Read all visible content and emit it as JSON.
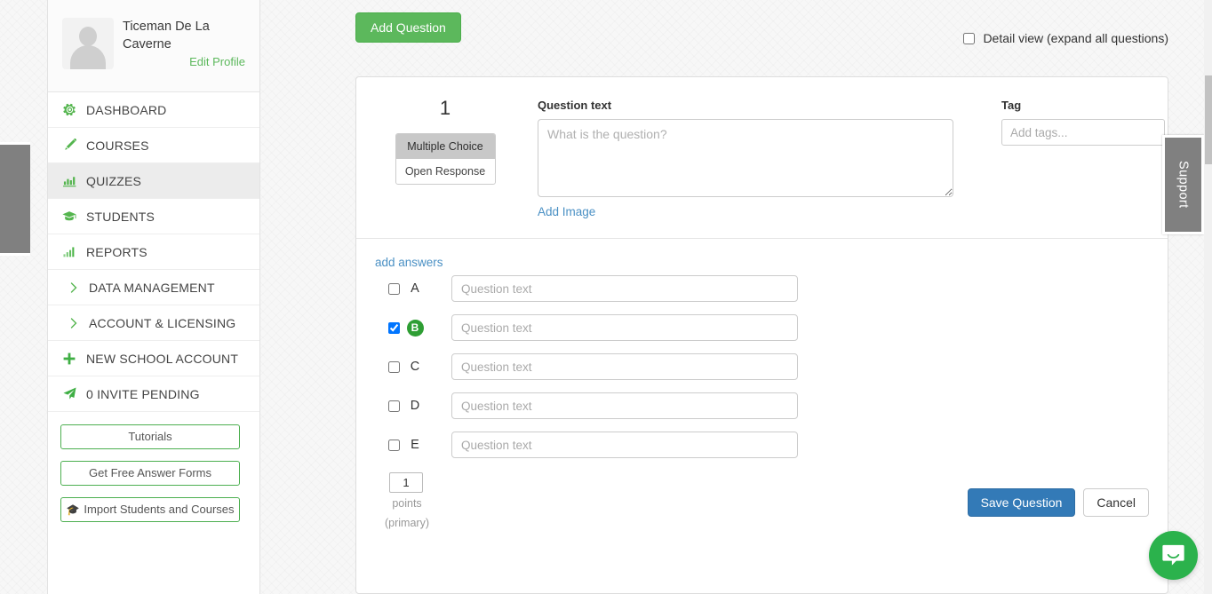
{
  "sidebar": {
    "profile": {
      "name": "Ticeman De La Caverne",
      "edit_link": "Edit Profile",
      "avatar_icon": "user-avatar-placeholder"
    },
    "nav": [
      {
        "label": "DASHBOARD",
        "icon": "gear-icon",
        "active": false,
        "sub": false
      },
      {
        "label": "COURSES",
        "icon": "pencil-icon",
        "active": false,
        "sub": false
      },
      {
        "label": "QUIZZES",
        "icon": "bar-chart-icon",
        "active": true,
        "sub": false
      },
      {
        "label": "STUDENTS",
        "icon": "graduation-cap-icon",
        "active": false,
        "sub": false
      },
      {
        "label": "REPORTS",
        "icon": "signal-bars-icon",
        "active": false,
        "sub": false
      },
      {
        "label": "DATA MANAGEMENT",
        "icon": "chevron-right-icon",
        "active": false,
        "sub": true
      },
      {
        "label": "ACCOUNT & LICENSING",
        "icon": "chevron-right-icon",
        "active": false,
        "sub": true
      },
      {
        "label": "NEW SCHOOL ACCOUNT",
        "icon": "plus-icon",
        "active": false,
        "sub": false
      },
      {
        "label": "0 INVITE PENDING",
        "icon": "paper-plane-icon",
        "active": false,
        "sub": false
      }
    ],
    "buttons": [
      {
        "label": "Tutorials",
        "icon": null
      },
      {
        "label": "Get Free Answer Forms",
        "icon": null
      },
      {
        "label": "Import Students and Courses",
        "icon": "graduation-cap-icon"
      }
    ]
  },
  "toolbar": {
    "add_question_label": "Add Question",
    "detail_view_label": "Detail view (expand all questions)",
    "detail_view_checked": false
  },
  "question_card": {
    "number": "1",
    "types": [
      {
        "label": "Multiple Choice",
        "selected": true
      },
      {
        "label": "Open Response",
        "selected": false
      }
    ],
    "question_text_label": "Question text",
    "question_text_value": "",
    "question_text_placeholder": "What is the question?",
    "add_image_label": "Add Image",
    "tag_label": "Tag",
    "tag_value": "",
    "tag_placeholder": "Add tags...",
    "add_answers_label": "add answers",
    "answers": [
      {
        "letter": "A",
        "checked": false,
        "value": "",
        "placeholder": "Question text"
      },
      {
        "letter": "B",
        "checked": true,
        "value": "",
        "placeholder": "Question text"
      },
      {
        "letter": "C",
        "checked": false,
        "value": "",
        "placeholder": "Question text"
      },
      {
        "letter": "D",
        "checked": false,
        "value": "",
        "placeholder": "Question text"
      },
      {
        "letter": "E",
        "checked": false,
        "value": "",
        "placeholder": "Question text"
      }
    ],
    "points_value": "1",
    "points_label": "points",
    "points_sublabel": "(primary)",
    "save_label": "Save Question",
    "cancel_label": "Cancel"
  },
  "support_tab": {
    "label": "Support"
  },
  "chat": {
    "icon": "chat-bubble-smile-icon"
  },
  "colors": {
    "brand_green": "#5cb85c",
    "accent_green": "#2e9e34",
    "link_blue": "#4a90c4",
    "save_blue": "#337ab7",
    "chat_green": "#2bb24c",
    "support_gray": "#808080"
  }
}
